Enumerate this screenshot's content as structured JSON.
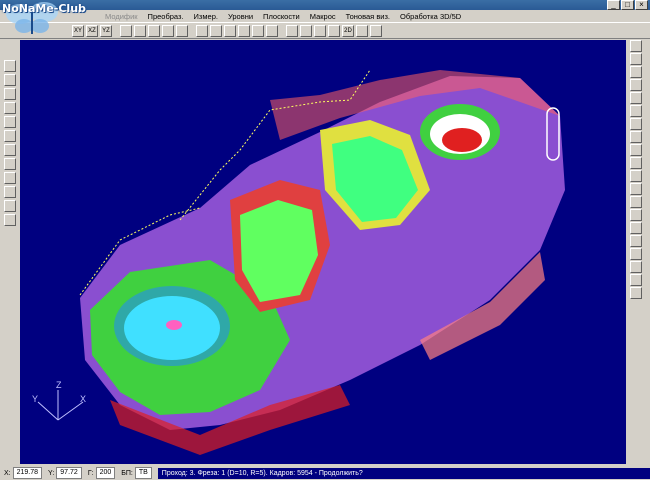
{
  "watermark": {
    "text": "NoNaMe-Club"
  },
  "window": {
    "min": "_",
    "max": "□",
    "close": "×"
  },
  "menu": {
    "items": [
      {
        "label": "Модифик",
        "enabled": false
      },
      {
        "label": "Преобраз.",
        "enabled": true
      },
      {
        "label": "Измер.",
        "enabled": true
      },
      {
        "label": "Уровни",
        "enabled": true
      },
      {
        "label": "Плоскости",
        "enabled": true
      },
      {
        "label": "Макрос",
        "enabled": true
      },
      {
        "label": "Тоновая виз.",
        "enabled": true
      },
      {
        "label": "Обработка 3D/5D",
        "enabled": true
      }
    ]
  },
  "toolbar": {
    "buttons": [
      "XY",
      "XZ",
      "YZ",
      "",
      "",
      "",
      "",
      "",
      "",
      "",
      "",
      "",
      "",
      "",
      "",
      "",
      "",
      "",
      "2D",
      "",
      ""
    ]
  },
  "axes_label": {
    "y": "Y",
    "z": "Z",
    "x": "X"
  },
  "status": {
    "x_label": "X:",
    "x_value": "219.78",
    "y_label": "Y:",
    "y_value": "97.72",
    "g_label": "Г:",
    "g_value": "200",
    "bp_label": "БП:",
    "tv_label": "ТВ",
    "message": "Проход: 3. Фреза: 1 (D=10, R=5). Кадров: 5954 - Продолжить?"
  },
  "colors": {
    "viewport_bg": "#000080",
    "part_green": "#40d040",
    "part_purple": "#8a4fd0",
    "part_red": "#e02020",
    "part_cyan": "#40e0ff",
    "part_yellow": "#f0f040",
    "toolpath": "#ffff60"
  }
}
